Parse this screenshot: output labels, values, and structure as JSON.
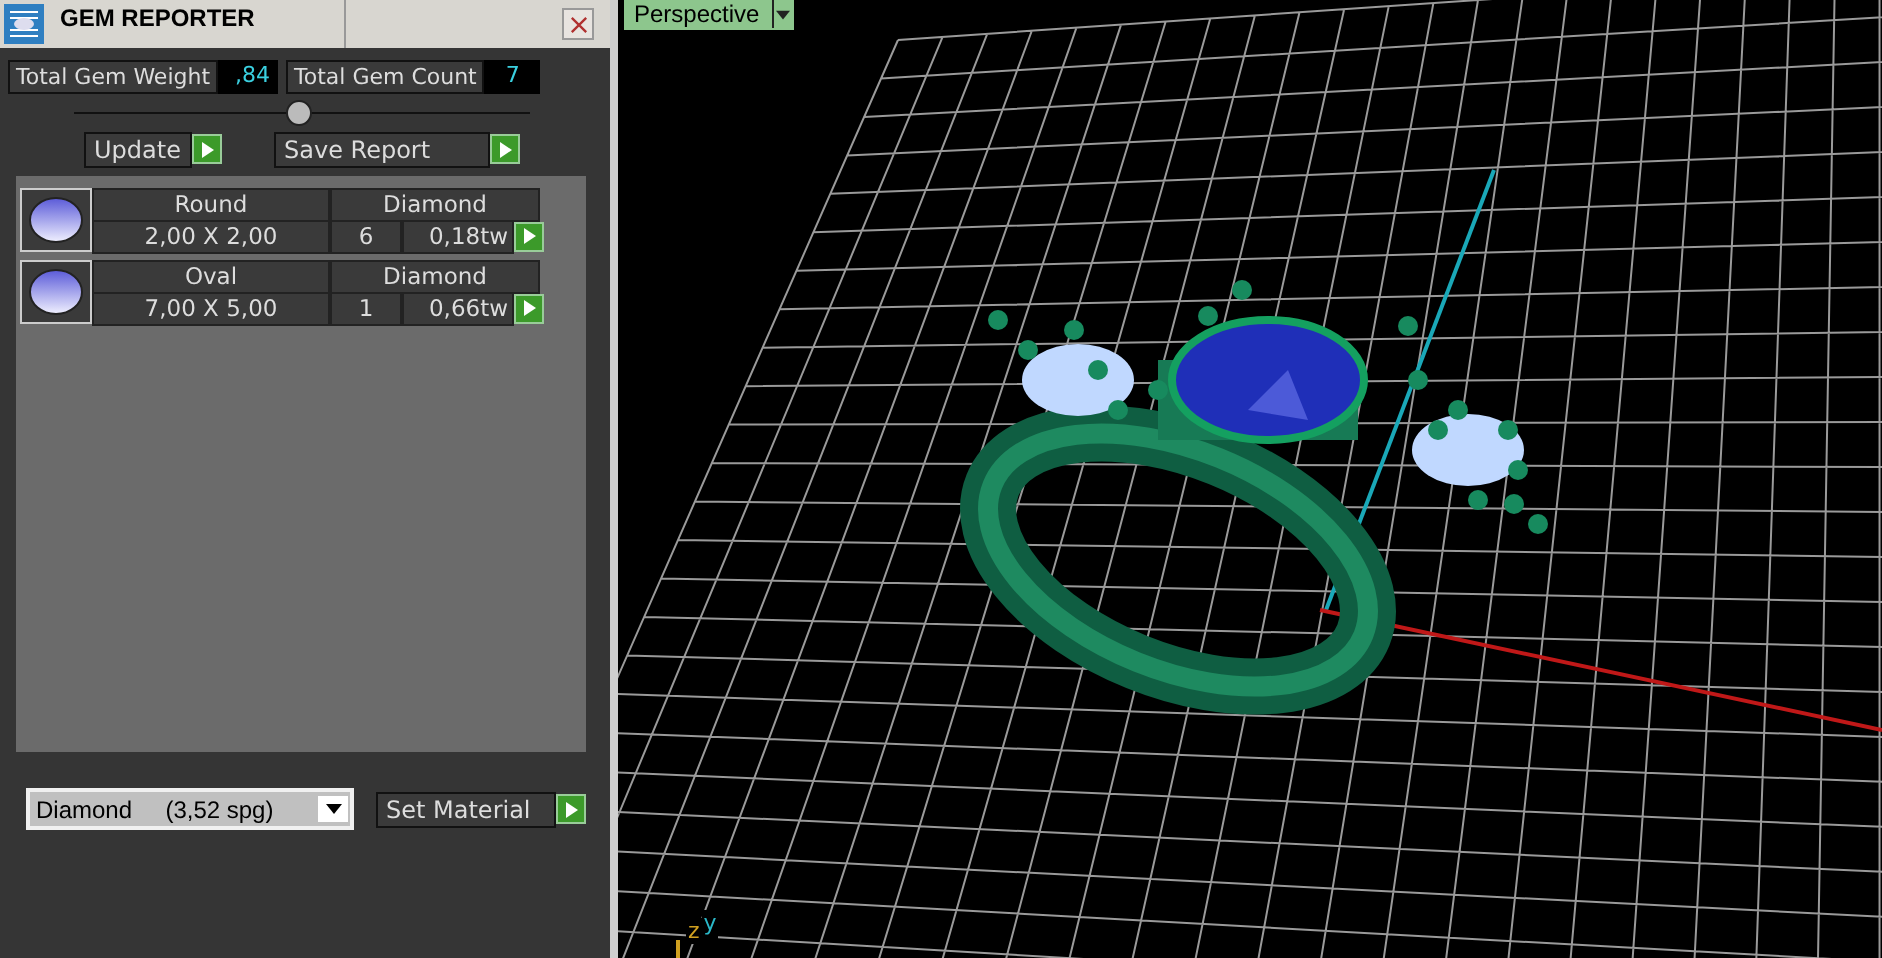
{
  "window": {
    "title": "GEM REPORTER"
  },
  "stats": [
    {
      "label": "Total Gem Weight",
      "value": ",84"
    },
    {
      "label": "Total Gem Count",
      "value": "7"
    }
  ],
  "slider": {
    "level": 0.49
  },
  "actions": [
    {
      "label": "Update"
    },
    {
      "label": "Save Report"
    }
  ],
  "gems": [
    {
      "shape": "Round",
      "material": "Diamond",
      "size": "2,00 X 2,00",
      "count": "6",
      "weight": "0,18tw"
    },
    {
      "shape": "Oval",
      "material": "Diamond",
      "size": "7,00 X 5,00",
      "count": "1",
      "weight": "0,66tw"
    }
  ],
  "material_select": {
    "value": "Diamond     (3,52 spg)"
  },
  "set_material": {
    "label": "Set Material"
  },
  "viewport": {
    "view_label": "Perspective",
    "axis_labels": [
      "z",
      "y"
    ]
  }
}
